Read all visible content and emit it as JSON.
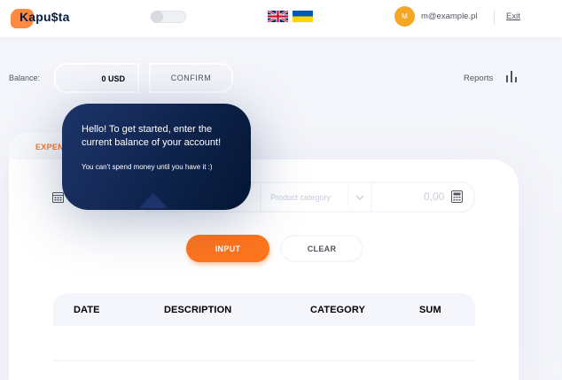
{
  "header": {
    "logo_text": "Kapu$ta",
    "user_initial": "M",
    "user_email": "m@example.pl",
    "exit_label": "Exit",
    "languages": [
      "en",
      "uk"
    ]
  },
  "balance": {
    "label": "Balance:",
    "amount": "0 USD",
    "confirm_label": "CONFIRM",
    "reports_label": "Reports"
  },
  "tabs": {
    "expenses_label": "EXPENSES"
  },
  "form": {
    "category_placeholder": "Product category",
    "amount_value": "0,00",
    "input_label": "INPUT",
    "clear_label": "CLEAR"
  },
  "table": {
    "columns": [
      "DATE",
      "DESCRIPTION",
      "CATEGORY",
      "SUM"
    ]
  },
  "tooltip": {
    "main": "Hello! To get started, enter the current balance of your account!",
    "sub": "You can't spend money until you have it :)"
  },
  "colors": {
    "accent": "#ff751d",
    "tooltip_bg": "#1d346a",
    "page_bg": "#f5f6fb",
    "avatar_bg": "#f5a623"
  }
}
